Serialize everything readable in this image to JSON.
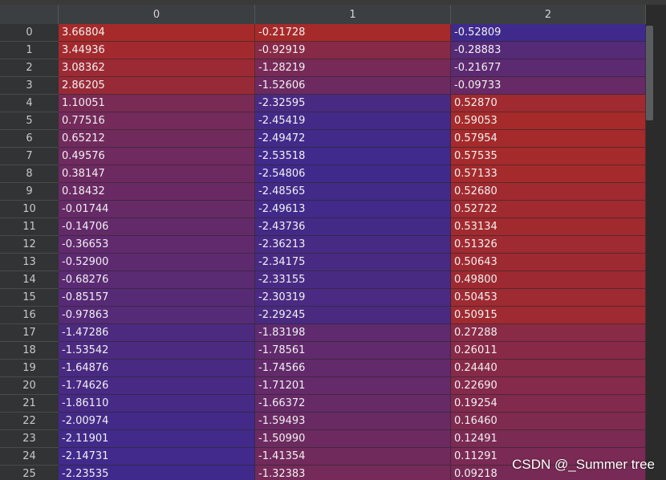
{
  "columns": [
    "0",
    "1",
    "2"
  ],
  "rows": [
    {
      "index": "0",
      "values": [
        "3.66804",
        "-0.21728",
        "-0.52809"
      ]
    },
    {
      "index": "1",
      "values": [
        "3.44936",
        "-0.92919",
        "-0.28883"
      ]
    },
    {
      "index": "2",
      "values": [
        "3.08362",
        "-1.28219",
        "-0.21677"
      ]
    },
    {
      "index": "3",
      "values": [
        "2.86205",
        "-1.52606",
        "-0.09733"
      ]
    },
    {
      "index": "4",
      "values": [
        "1.10051",
        "-2.32595",
        "0.52870"
      ]
    },
    {
      "index": "5",
      "values": [
        "0.77516",
        "-2.45419",
        "0.59053"
      ]
    },
    {
      "index": "6",
      "values": [
        "0.65212",
        "-2.49472",
        "0.57954"
      ]
    },
    {
      "index": "7",
      "values": [
        "0.49576",
        "-2.53518",
        "0.57535"
      ]
    },
    {
      "index": "8",
      "values": [
        "0.38147",
        "-2.54806",
        "0.57133"
      ]
    },
    {
      "index": "9",
      "values": [
        "0.18432",
        "-2.48565",
        "0.52680"
      ]
    },
    {
      "index": "10",
      "values": [
        "-0.01744",
        "-2.49613",
        "0.52722"
      ]
    },
    {
      "index": "11",
      "values": [
        "-0.14706",
        "-2.43736",
        "0.53134"
      ]
    },
    {
      "index": "12",
      "values": [
        "-0.36653",
        "-2.36213",
        "0.51326"
      ]
    },
    {
      "index": "13",
      "values": [
        "-0.52900",
        "-2.34175",
        "0.50643"
      ]
    },
    {
      "index": "14",
      "values": [
        "-0.68276",
        "-2.33155",
        "0.49800"
      ]
    },
    {
      "index": "15",
      "values": [
        "-0.85157",
        "-2.30319",
        "0.50453"
      ]
    },
    {
      "index": "16",
      "values": [
        "-0.97863",
        "-2.29245",
        "0.50915"
      ]
    },
    {
      "index": "17",
      "values": [
        "-1.47286",
        "-1.83198",
        "0.27288"
      ]
    },
    {
      "index": "18",
      "values": [
        "-1.53542",
        "-1.78561",
        "0.26011"
      ]
    },
    {
      "index": "19",
      "values": [
        "-1.64876",
        "-1.74566",
        "0.24440"
      ]
    },
    {
      "index": "20",
      "values": [
        "-1.74626",
        "-1.71201",
        "0.22690"
      ]
    },
    {
      "index": "21",
      "values": [
        "-1.86110",
        "-1.66372",
        "0.19254"
      ]
    },
    {
      "index": "22",
      "values": [
        "-2.00974",
        "-1.59493",
        "0.16460"
      ]
    },
    {
      "index": "23",
      "values": [
        "-2.11901",
        "-1.50990",
        "0.12491"
      ]
    },
    {
      "index": "24",
      "values": [
        "-2.14731",
        "-1.41354",
        "0.11291"
      ]
    },
    {
      "index": "25",
      "values": [
        "-2.23535",
        "-1.32383",
        "0.09218"
      ]
    }
  ],
  "heatmap_colors": {
    "low": "#3f2a8c",
    "high": "#a62a2a"
  },
  "watermark": "CSDN @_Summer tree"
}
